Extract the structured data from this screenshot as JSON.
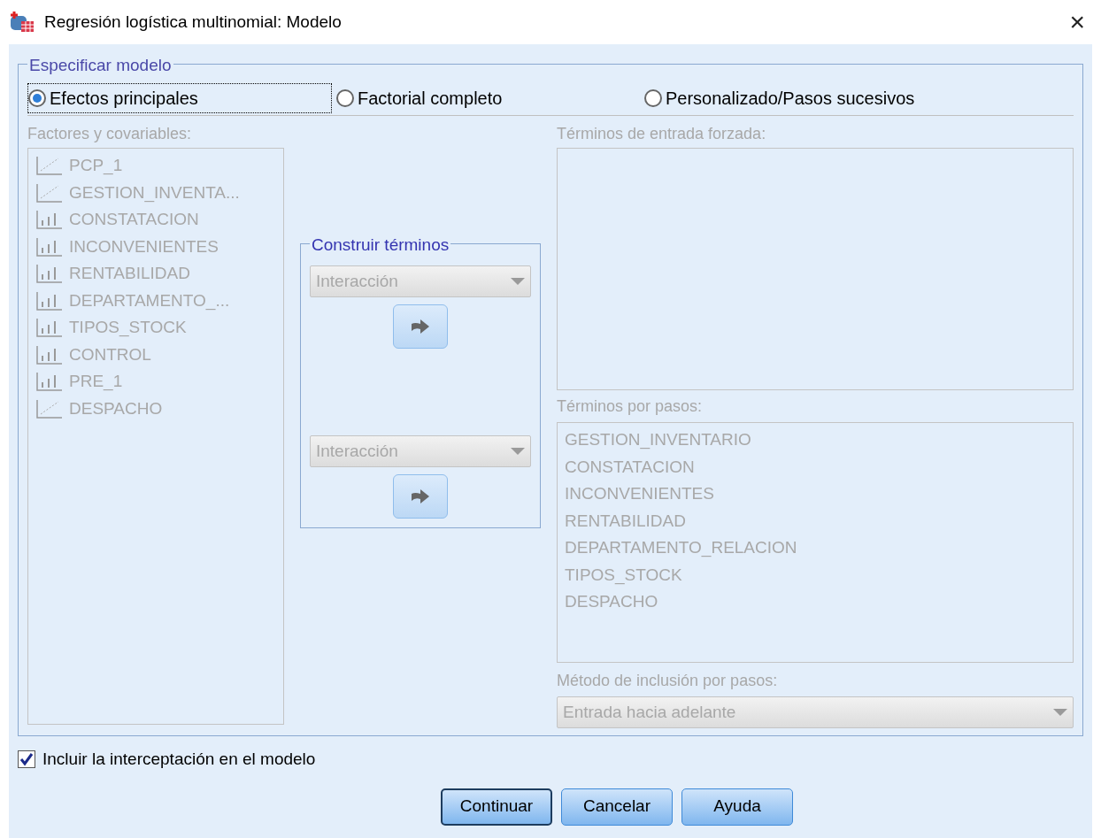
{
  "window": {
    "title": "Regresión logística multinomial: Modelo",
    "close": "×"
  },
  "model_group": {
    "title": "Especificar modelo",
    "radios": [
      {
        "label": "Efectos principales",
        "selected": true,
        "focused": true
      },
      {
        "label": "Factorial completo",
        "selected": false,
        "focused": false
      },
      {
        "label": "Personalizado/Pasos sucesivos",
        "selected": false,
        "focused": false
      }
    ],
    "factors": {
      "label": "Factores y covariables:",
      "disabled": true,
      "items": [
        {
          "label": "PCP_1",
          "kind": "scale"
        },
        {
          "label": "GESTION_INVENTA...",
          "kind": "scale"
        },
        {
          "label": "CONSTATACION",
          "kind": "ordinal"
        },
        {
          "label": "INCONVENIENTES",
          "kind": "ordinal"
        },
        {
          "label": "RENTABILIDAD",
          "kind": "ordinal"
        },
        {
          "label": "DEPARTAMENTO_...",
          "kind": "ordinal"
        },
        {
          "label": "TIPOS_STOCK",
          "kind": "ordinal"
        },
        {
          "label": "CONTROL",
          "kind": "ordinal"
        },
        {
          "label": "PRE_1",
          "kind": "ordinal"
        },
        {
          "label": "DESPACHO",
          "kind": "scale"
        }
      ]
    },
    "build_terms": {
      "title": "Construir términos",
      "dropdowns": [
        {
          "value": "Interacción",
          "disabled": true
        },
        {
          "value": "Interacción",
          "disabled": true
        }
      ]
    },
    "forced_terms": {
      "label": "Términos de entrada forzada:",
      "disabled": true
    },
    "stepwise_terms": {
      "label": "Términos por pasos:",
      "disabled": true,
      "items": [
        "GESTION_INVENTARIO",
        "CONSTATACION",
        "INCONVENIENTES",
        "RENTABILIDAD",
        "DEPARTAMENTO_RELACION",
        "TIPOS_STOCK",
        "DESPACHO"
      ]
    },
    "stepwise_method": {
      "label": "Método de inclusión por pasos:",
      "value": "Entrada hacia adelante",
      "disabled": true
    }
  },
  "intercept": {
    "label": "Incluir la interceptación en el modelo",
    "checked": true
  },
  "buttons": [
    {
      "label": "Continuar",
      "default": true
    },
    {
      "label": "Cancelar",
      "default": false
    },
    {
      "label": "Ayuda",
      "default": false
    }
  ]
}
